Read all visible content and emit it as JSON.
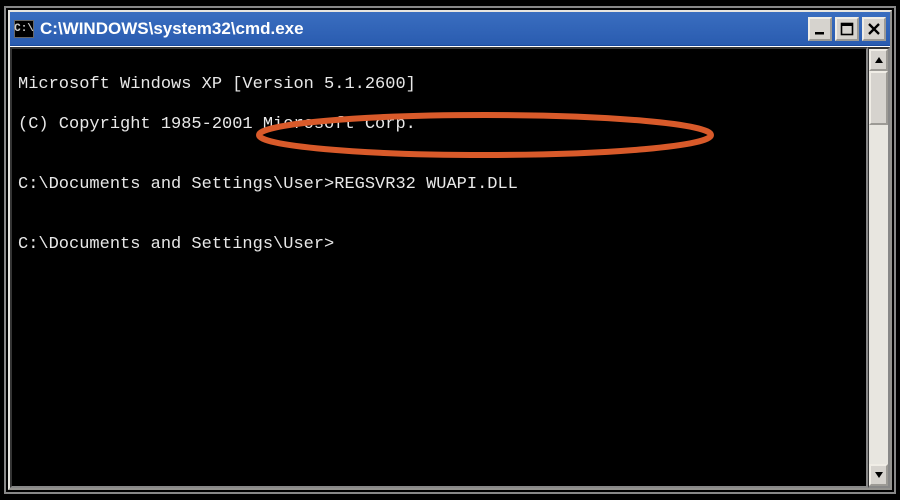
{
  "window": {
    "icon_text": "C:\\",
    "title": "C:\\WINDOWS\\system32\\cmd.exe",
    "minimize_label": "Minimize",
    "maximize_label": "Maximize",
    "close_label": "Close"
  },
  "console": {
    "lines": [
      "Microsoft Windows XP [Version 5.1.2600]",
      "(C) Copyright 1985-2001 Microsoft Corp.",
      "",
      "C:\\Documents and Settings\\User>REGSVR32 WUAPI.DLL",
      "",
      "C:\\Documents and Settings\\User>"
    ],
    "prompt": "C:\\Documents and Settings\\User>",
    "command": "REGSVR32 WUAPI.DLL"
  },
  "annotation": {
    "color": "#d85a2a"
  },
  "scrollbar": {
    "up_label": "Scroll up",
    "down_label": "Scroll down"
  }
}
